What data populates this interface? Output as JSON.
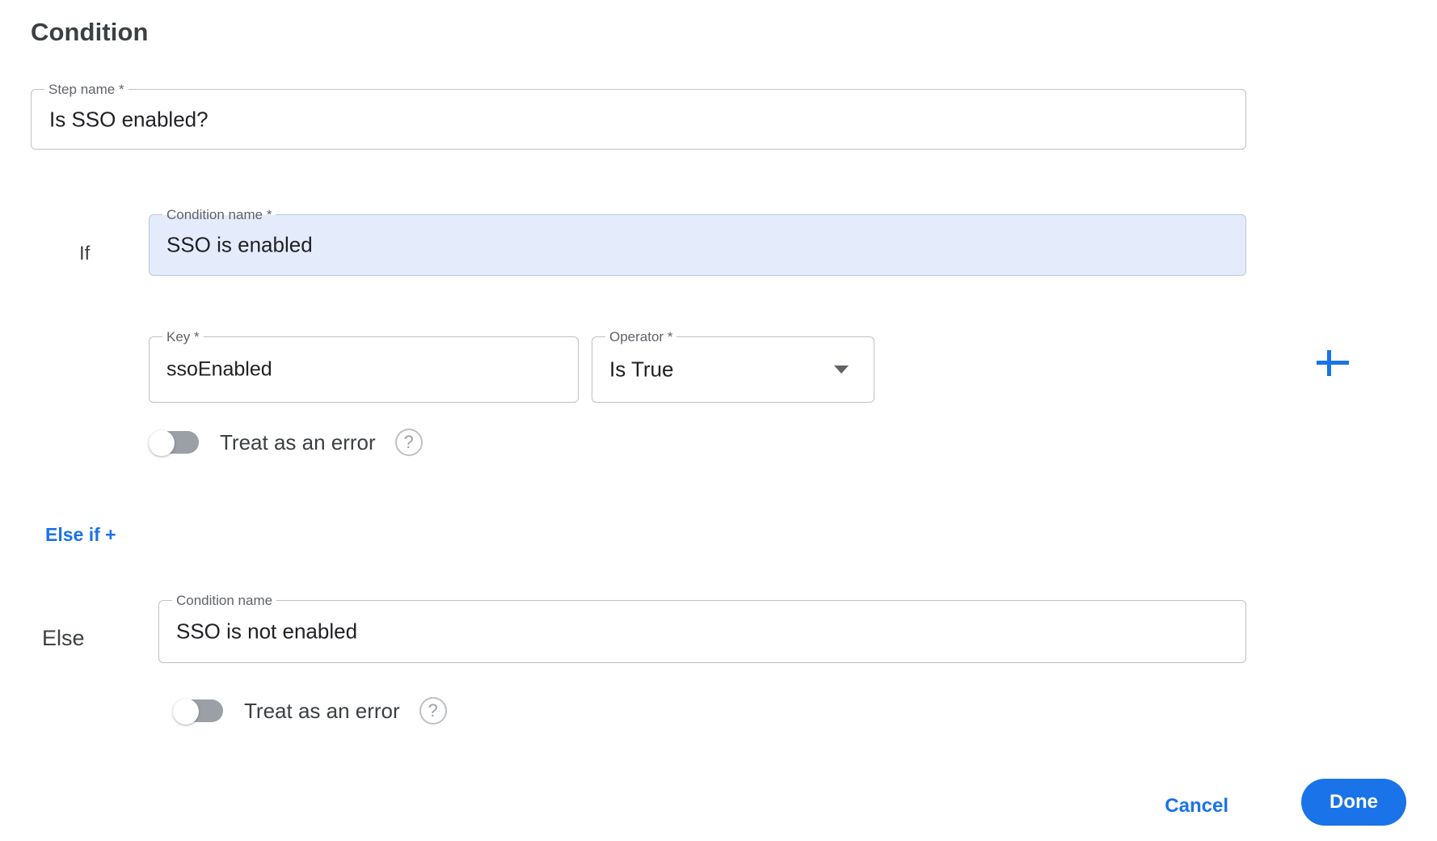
{
  "header": {
    "title": "Condition"
  },
  "step": {
    "label": "Step name",
    "required_marker": "*",
    "value": "Is SSO enabled?"
  },
  "if_branch": {
    "branch_label": "If",
    "condition_name": {
      "label": "Condition name",
      "required_marker": "*",
      "value": "SSO is enabled"
    },
    "key": {
      "label": "Key",
      "required_marker": "*",
      "value": "ssoEnabled"
    },
    "operator": {
      "label": "Operator",
      "required_marker": "*",
      "value": "Is True",
      "icon": "chevron-down-icon"
    },
    "add_button_icon": "plus-icon",
    "treat_as_error": {
      "label": "Treat as an error",
      "state": "off",
      "help_icon": "?"
    }
  },
  "else_if": {
    "label": "Else if +"
  },
  "else_branch": {
    "branch_label": "Else",
    "condition_name": {
      "label": "Condition name",
      "value": "SSO is not enabled"
    },
    "treat_as_error": {
      "label": "Treat as an error",
      "state": "off",
      "help_icon": "?"
    }
  },
  "footer": {
    "cancel_label": "Cancel",
    "done_label": "Done"
  },
  "colors": {
    "accent_blue": "#1a73e8",
    "focused_field_bg": "#e4ecfb",
    "border_gray": "#bdc1c6",
    "text_primary": "#3c4043",
    "text_secondary": "#5f6368",
    "toggle_off_track": "#9aa0a6"
  }
}
